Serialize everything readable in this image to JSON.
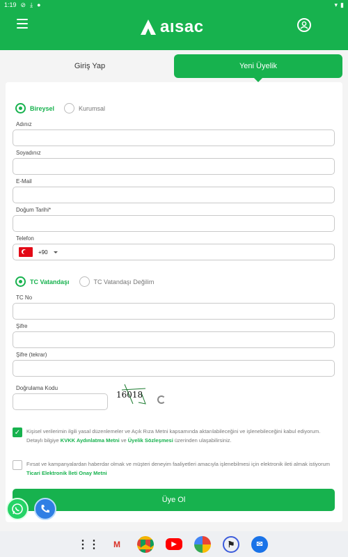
{
  "status_bar": {
    "time": "1:19"
  },
  "header": {
    "brand": "aısac",
    "menu_icon": "hamburger-icon",
    "user_icon": "user-circle-icon"
  },
  "tabs": [
    {
      "label": "Giriş Yap",
      "active": false
    },
    {
      "label": "Yeni Üyelik",
      "active": true
    }
  ],
  "account_type": {
    "options": [
      "Bireysel",
      "Kurumsal"
    ],
    "selected": "Bireysel"
  },
  "fields": {
    "first_name": {
      "label": "Adınız",
      "value": ""
    },
    "last_name": {
      "label": "Soyadınız",
      "value": ""
    },
    "email": {
      "label": "E-Mail",
      "value": ""
    },
    "birth_date": {
      "label": "Doğum Tarihi*",
      "value": ""
    },
    "phone": {
      "label": "Telefon",
      "country_code": "+90",
      "value": ""
    }
  },
  "citizenship": {
    "options": [
      "TC Vatandaşı",
      "TC Vatandaşı Değilim"
    ],
    "selected": "TC Vatandaşı"
  },
  "fields2": {
    "tc_no": {
      "label": "TC No",
      "value": ""
    },
    "password": {
      "label": "Şifre",
      "value": ""
    },
    "password_repeat": {
      "label": "Şifre (tekrar)",
      "value": ""
    },
    "verification_code": {
      "label": "Doğrulama Kodu",
      "value": ""
    }
  },
  "captcha": {
    "text": "16018"
  },
  "consents": [
    {
      "checked": true,
      "text_1": "Kişisel verilerimin ilgili yasal düzenlemeler ve Açık Rıza Metni kapsamında aktarılabileceğini ve işlenebileceğini kabul ediyorum. Detaylı bilgiye ",
      "link_1": "KVKK Aydınlatma Metni",
      "text_2": " ve ",
      "link_2": "Üyelik Sözleşmesi",
      "text_3": " üzerinden ulaşabilirsiniz."
    },
    {
      "checked": false,
      "text_1": "Fırsat ve kampanyalardan haberdar olmak ve müşteri deneyim faaliyetleri amacıyla işlenebilmesi için elektronik ileti almak istiyorum ",
      "link_1": "Ticari Elektronik İleti Onay Metni"
    }
  ],
  "submit_label": "Üye Ol",
  "floating": {
    "whatsapp_icon": "whatsapp-icon",
    "call_icon": "phone-icon"
  },
  "colors": {
    "brand": "#17b24e"
  }
}
